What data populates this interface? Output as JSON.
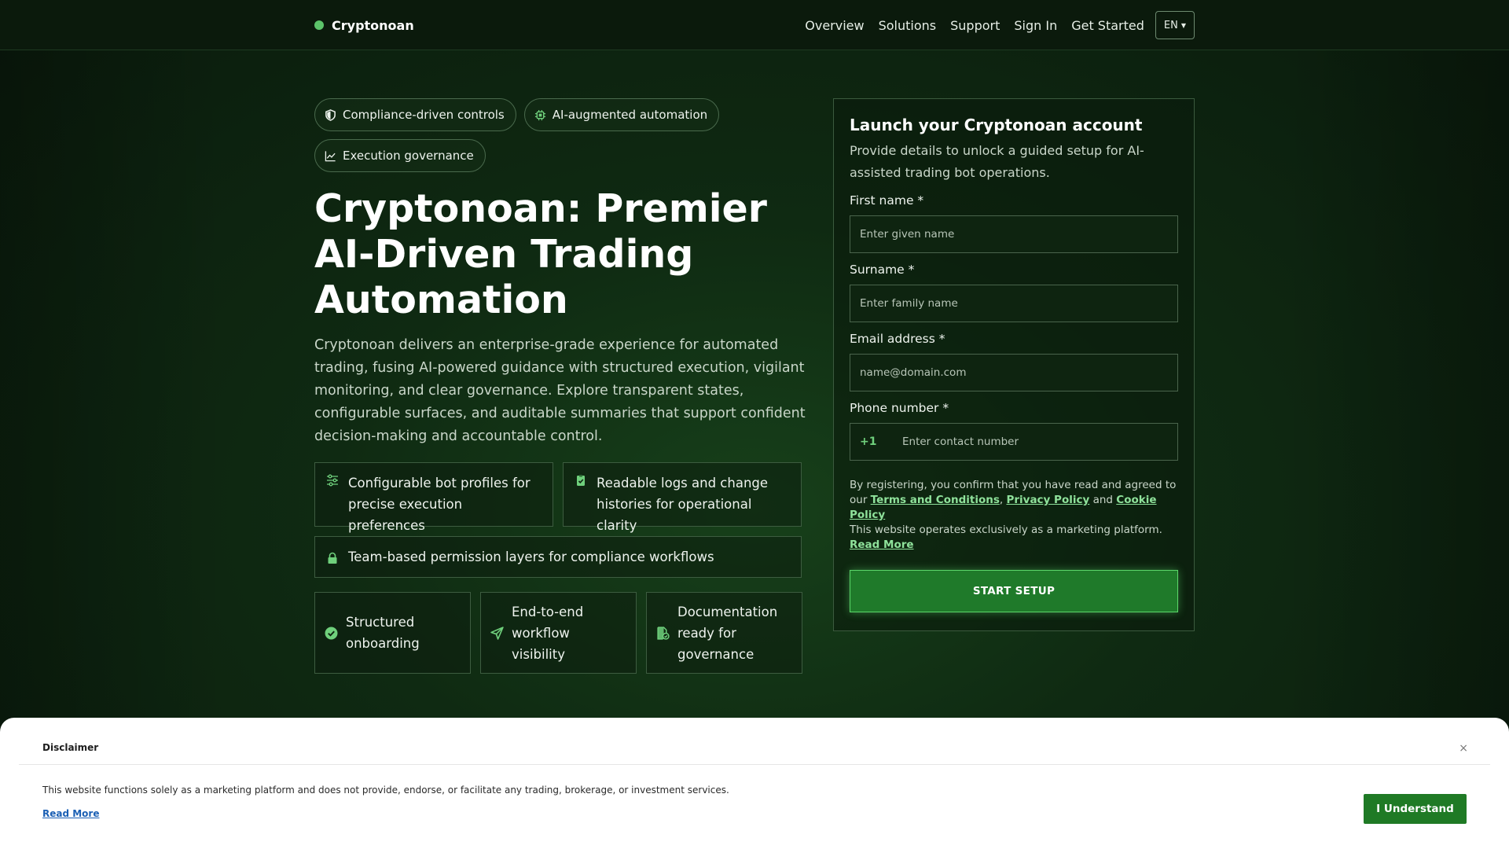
{
  "header": {
    "brand": "Cryptonoan",
    "nav": [
      "Overview",
      "Solutions",
      "Support",
      "Sign In",
      "Get Started"
    ],
    "language": "EN"
  },
  "hero": {
    "chips": [
      "Compliance-driven controls",
      "AI-augmented automation",
      "Execution governance"
    ],
    "title": "Cryptonoan: Premier AI-Driven Trading Automation",
    "description": "Cryptonoan delivers an enterprise-grade experience for automated trading, fusing AI-powered guidance with structured execution, vigilant monitoring, and clear governance. Explore transparent states, configurable surfaces, and auditable summaries that support confident decision-making and accountable control.",
    "features": [
      "Configurable bot profiles for precise execution preferences",
      "Readable logs and change histories for operational clarity",
      "Team-based permission layers for compliance workflows"
    ],
    "highlights": [
      "Structured onboarding",
      "End-to-end workflow visibility",
      "Documentation ready for governance"
    ]
  },
  "form": {
    "title": "Launch your Cryptonoan account",
    "subtitle": "Provide details to unlock a guided setup for AI-assisted trading bot operations.",
    "first_name_label": "First name *",
    "first_name_placeholder": "Enter given name",
    "surname_label": "Surname *",
    "surname_placeholder": "Enter family name",
    "email_label": "Email address *",
    "email_placeholder": "name@domain.com",
    "phone_label": "Phone number *",
    "phone_code": "+1",
    "phone_placeholder": "Enter contact number",
    "consent_prefix": "By registering, you confirm that you have read and agreed to our",
    "terms_link": "Terms and Conditions",
    "comma": ",",
    "privacy_link": "Privacy Policy",
    "and": "and",
    "cookie_link": "Cookie Policy",
    "marketing_note": "This website operates exclusively as a marketing platform.",
    "read_more": "Read More",
    "submit_label": "START SETUP"
  },
  "disclaimer": {
    "title": "Disclaimer",
    "close": "×",
    "text": "This website functions solely as a marketing platform and does not provide, endorse, or facilitate any trading, brokerage, or investment services.",
    "read_more": "Read More",
    "accept_label": "I Understand"
  },
  "colors": {
    "accent": "#5cc46a",
    "cta": "#1f7a2a",
    "background": "#0f2a12"
  }
}
